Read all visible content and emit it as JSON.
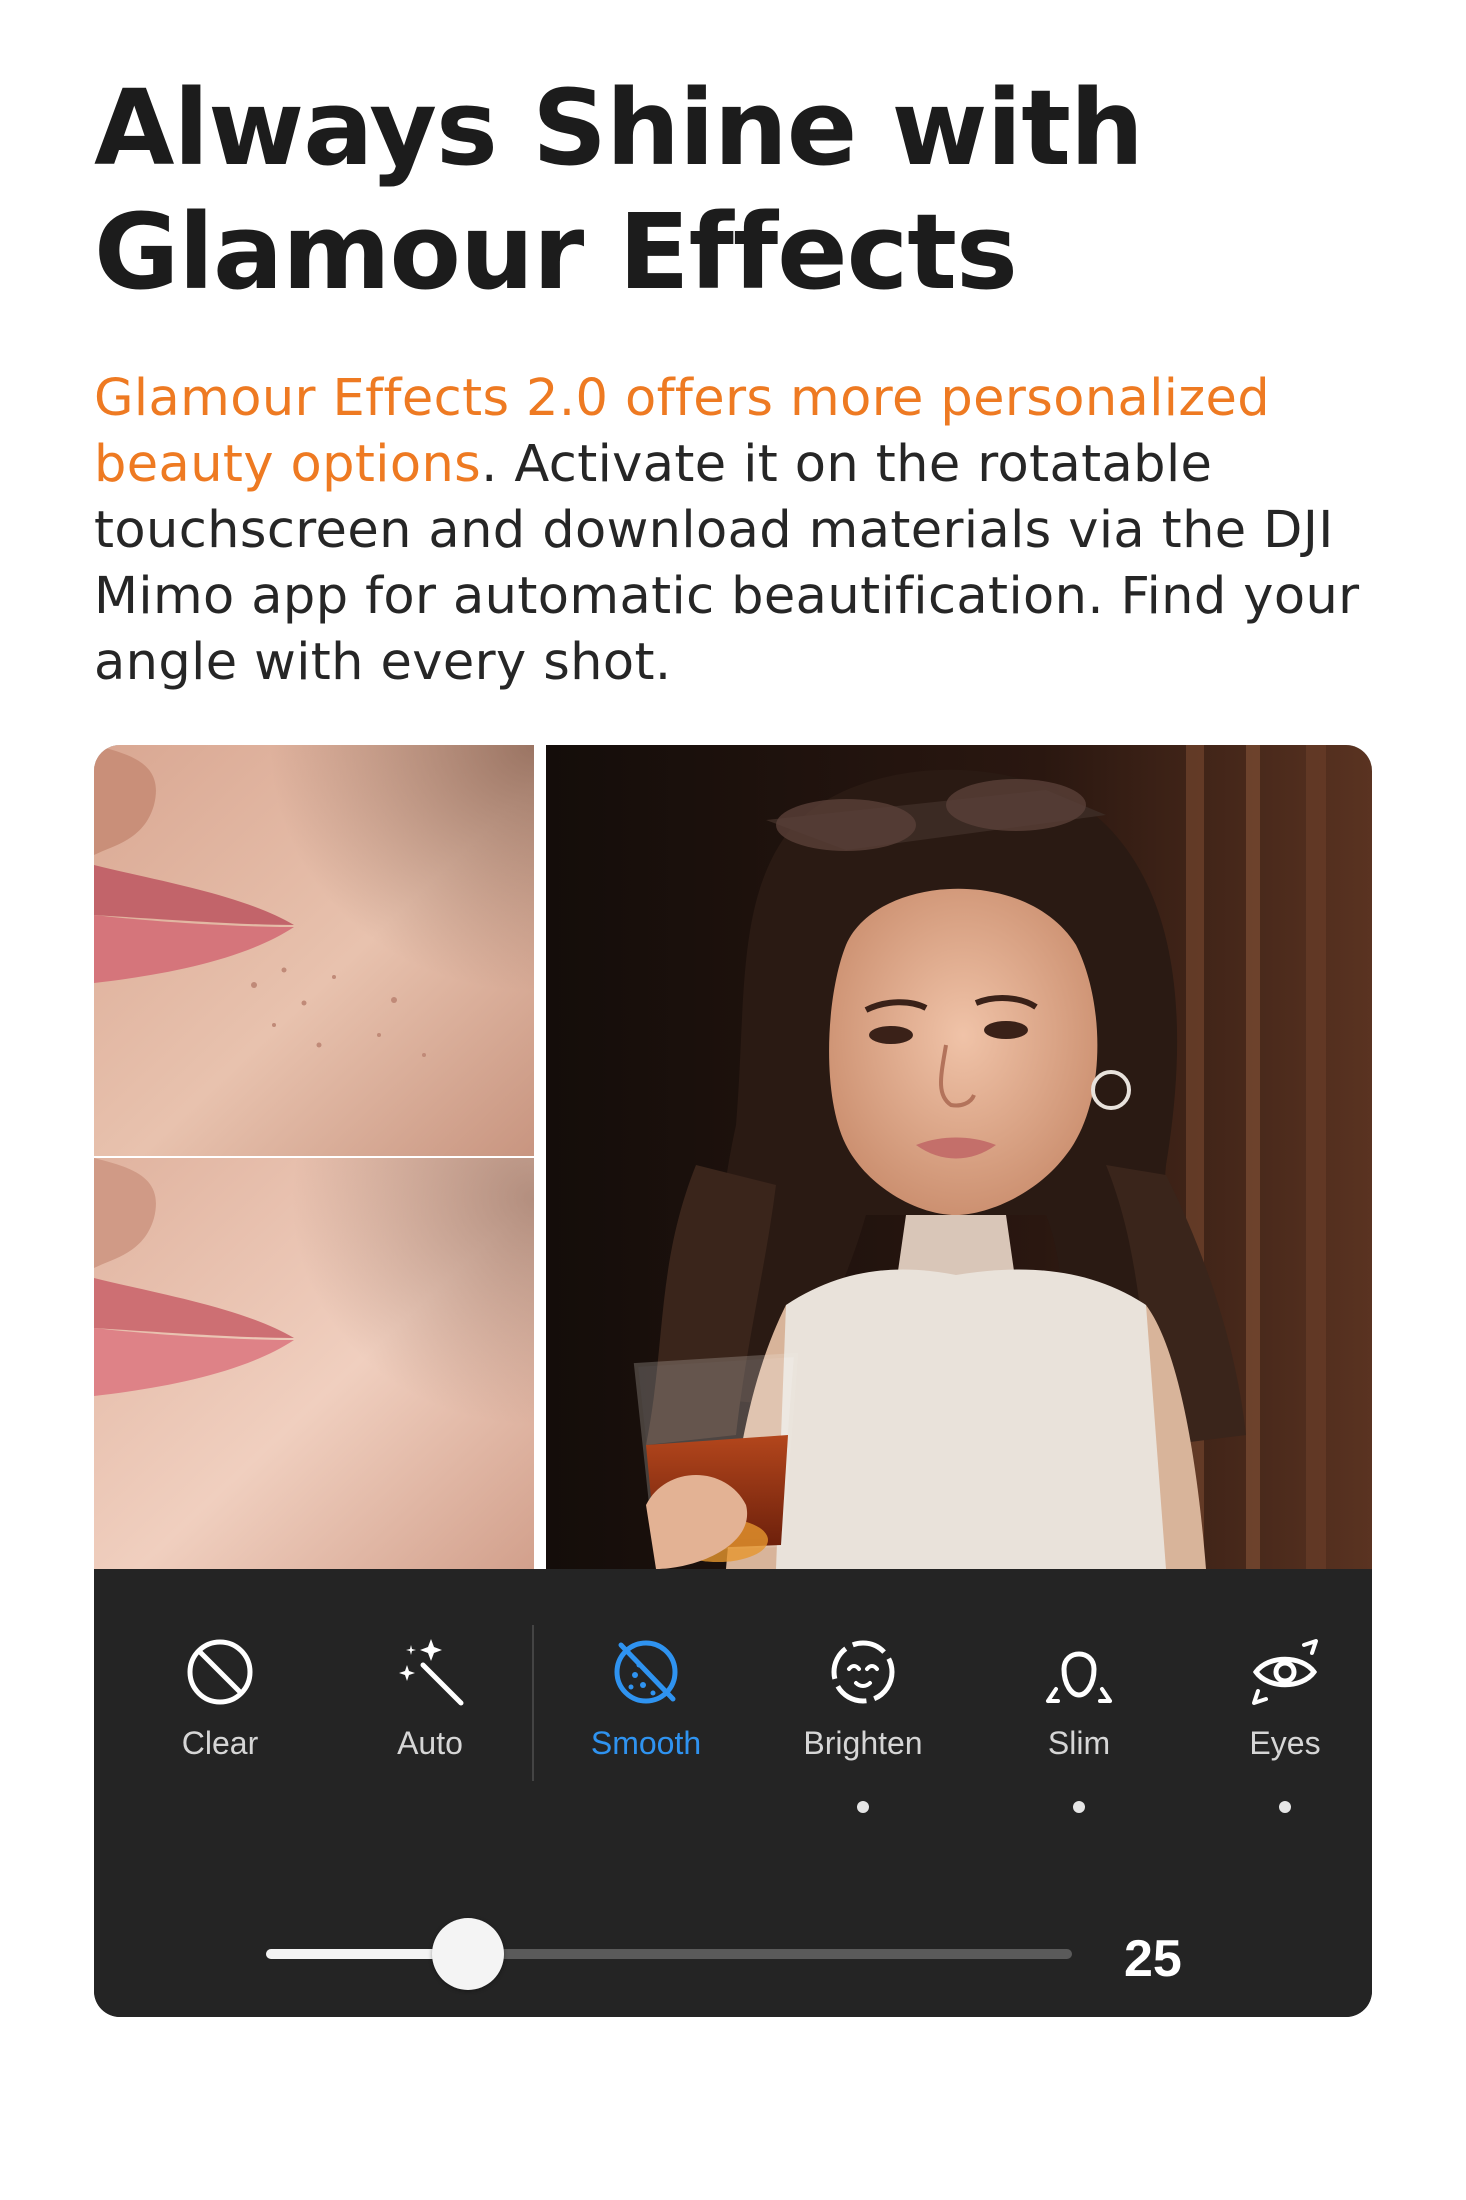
{
  "heading": {
    "line1": "Always Shine with",
    "line2": "Glamour Effects"
  },
  "intro": {
    "accent": "Glamour Effects 2.0 offers more personalized beauty options",
    "rest": ". Activate it on the rotatable touchscreen and download materials via the DJI Mimo app for automatic beautification. Find your angle with every shot."
  },
  "colors": {
    "accent": "#ee7a22",
    "active_tool": "#2f93f0",
    "panel_bg": "#242424"
  },
  "tools": [
    {
      "label": "Clear",
      "icon": "clear-icon",
      "active": false,
      "has_dot": false
    },
    {
      "label": "Auto",
      "icon": "magic-wand-icon",
      "active": false,
      "has_dot": false
    },
    {
      "label": "Smooth",
      "icon": "smooth-icon",
      "active": true,
      "has_dot": false
    },
    {
      "label": "Brighten",
      "icon": "brighten-face-icon",
      "active": false,
      "has_dot": true
    },
    {
      "label": "Slim",
      "icon": "slim-face-icon",
      "active": false,
      "has_dot": true
    },
    {
      "label": "Eyes",
      "icon": "eye-icon",
      "active": false,
      "has_dot": true
    }
  ],
  "slider": {
    "value": "25",
    "fraction": 0.25
  }
}
